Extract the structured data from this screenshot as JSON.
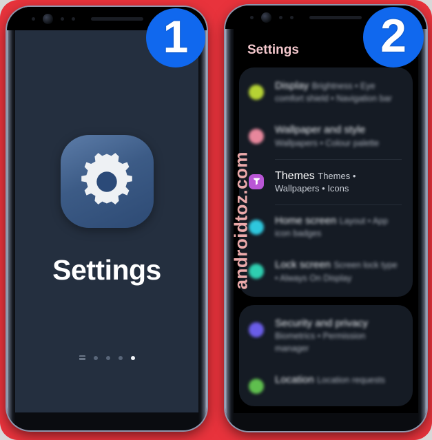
{
  "background_color": "#e8333c",
  "watermark": {
    "text": "androidtoz.com",
    "color": "#ffb7b7"
  },
  "badges": [
    {
      "name": "step-1",
      "label": "1",
      "color": "#1068ee"
    },
    {
      "name": "step-2",
      "label": "2",
      "color": "#1068ee"
    }
  ],
  "phone_left": {
    "app": {
      "label": "Settings",
      "icon": "gear-icon",
      "icon_bg": "#3c5b86"
    },
    "page_indicator": {
      "count": 5,
      "active_index": 4,
      "first_is_list": true
    }
  },
  "phone_right": {
    "header": {
      "title": "Settings",
      "color": "#f4c8cd"
    },
    "cards": [
      {
        "items": [
          {
            "title": "Display",
            "subtitle": "Brightness • Eye comfort shield • Navigation bar",
            "icon_color": "#b6d334",
            "focused": false
          },
          {
            "title": "Wallpaper and style",
            "subtitle": "Wallpapers • Colour palette",
            "icon_color": "#e7879c",
            "focused": false
          },
          {
            "title": "Themes",
            "subtitle": "Themes • Wallpapers • Icons",
            "icon_color": "#b956d6",
            "icon": "themes-icon",
            "focused": true
          },
          {
            "title": "Home screen",
            "subtitle": "Layout • App icon badges",
            "icon_color": "#2ec7dd",
            "focused": false
          },
          {
            "title": "Lock screen",
            "subtitle": "Screen lock type • Always On Display",
            "icon_color": "#2ecfb0",
            "focused": false
          }
        ]
      },
      {
        "items": [
          {
            "title": "Security and privacy",
            "subtitle": "Biometrics • Permission manager",
            "icon_color": "#6a5de8",
            "focused": false
          },
          {
            "title": "Location",
            "subtitle": "Location requests",
            "icon_color": "#5fbf4e",
            "focused": false
          }
        ]
      }
    ]
  }
}
